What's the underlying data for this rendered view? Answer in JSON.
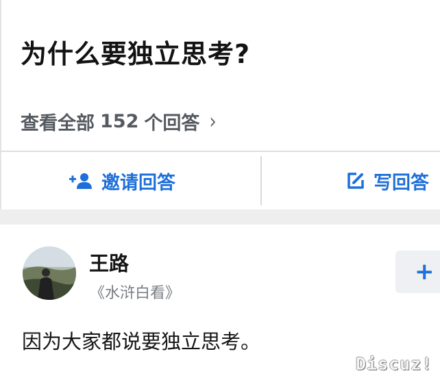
{
  "question": {
    "title": "为什么要独立思考?",
    "view_all_prefix": "查看全部",
    "answer_count": "152",
    "view_all_suffix": "个回答",
    "chevron": "›"
  },
  "actions": {
    "invite_label": "邀请回答",
    "write_label": "写回答"
  },
  "answer": {
    "author_name": "王路",
    "author_subtitle": "《水浒白看》",
    "follow_label": "+",
    "text": "因为大家都说要独立思考。"
  },
  "watermark": "Discuz!",
  "colors": {
    "accent": "#1e6fd9",
    "muted": "#555a60",
    "separator": "#eeeeef"
  },
  "icons": {
    "invite": "add-person-icon",
    "write": "edit-icon"
  }
}
